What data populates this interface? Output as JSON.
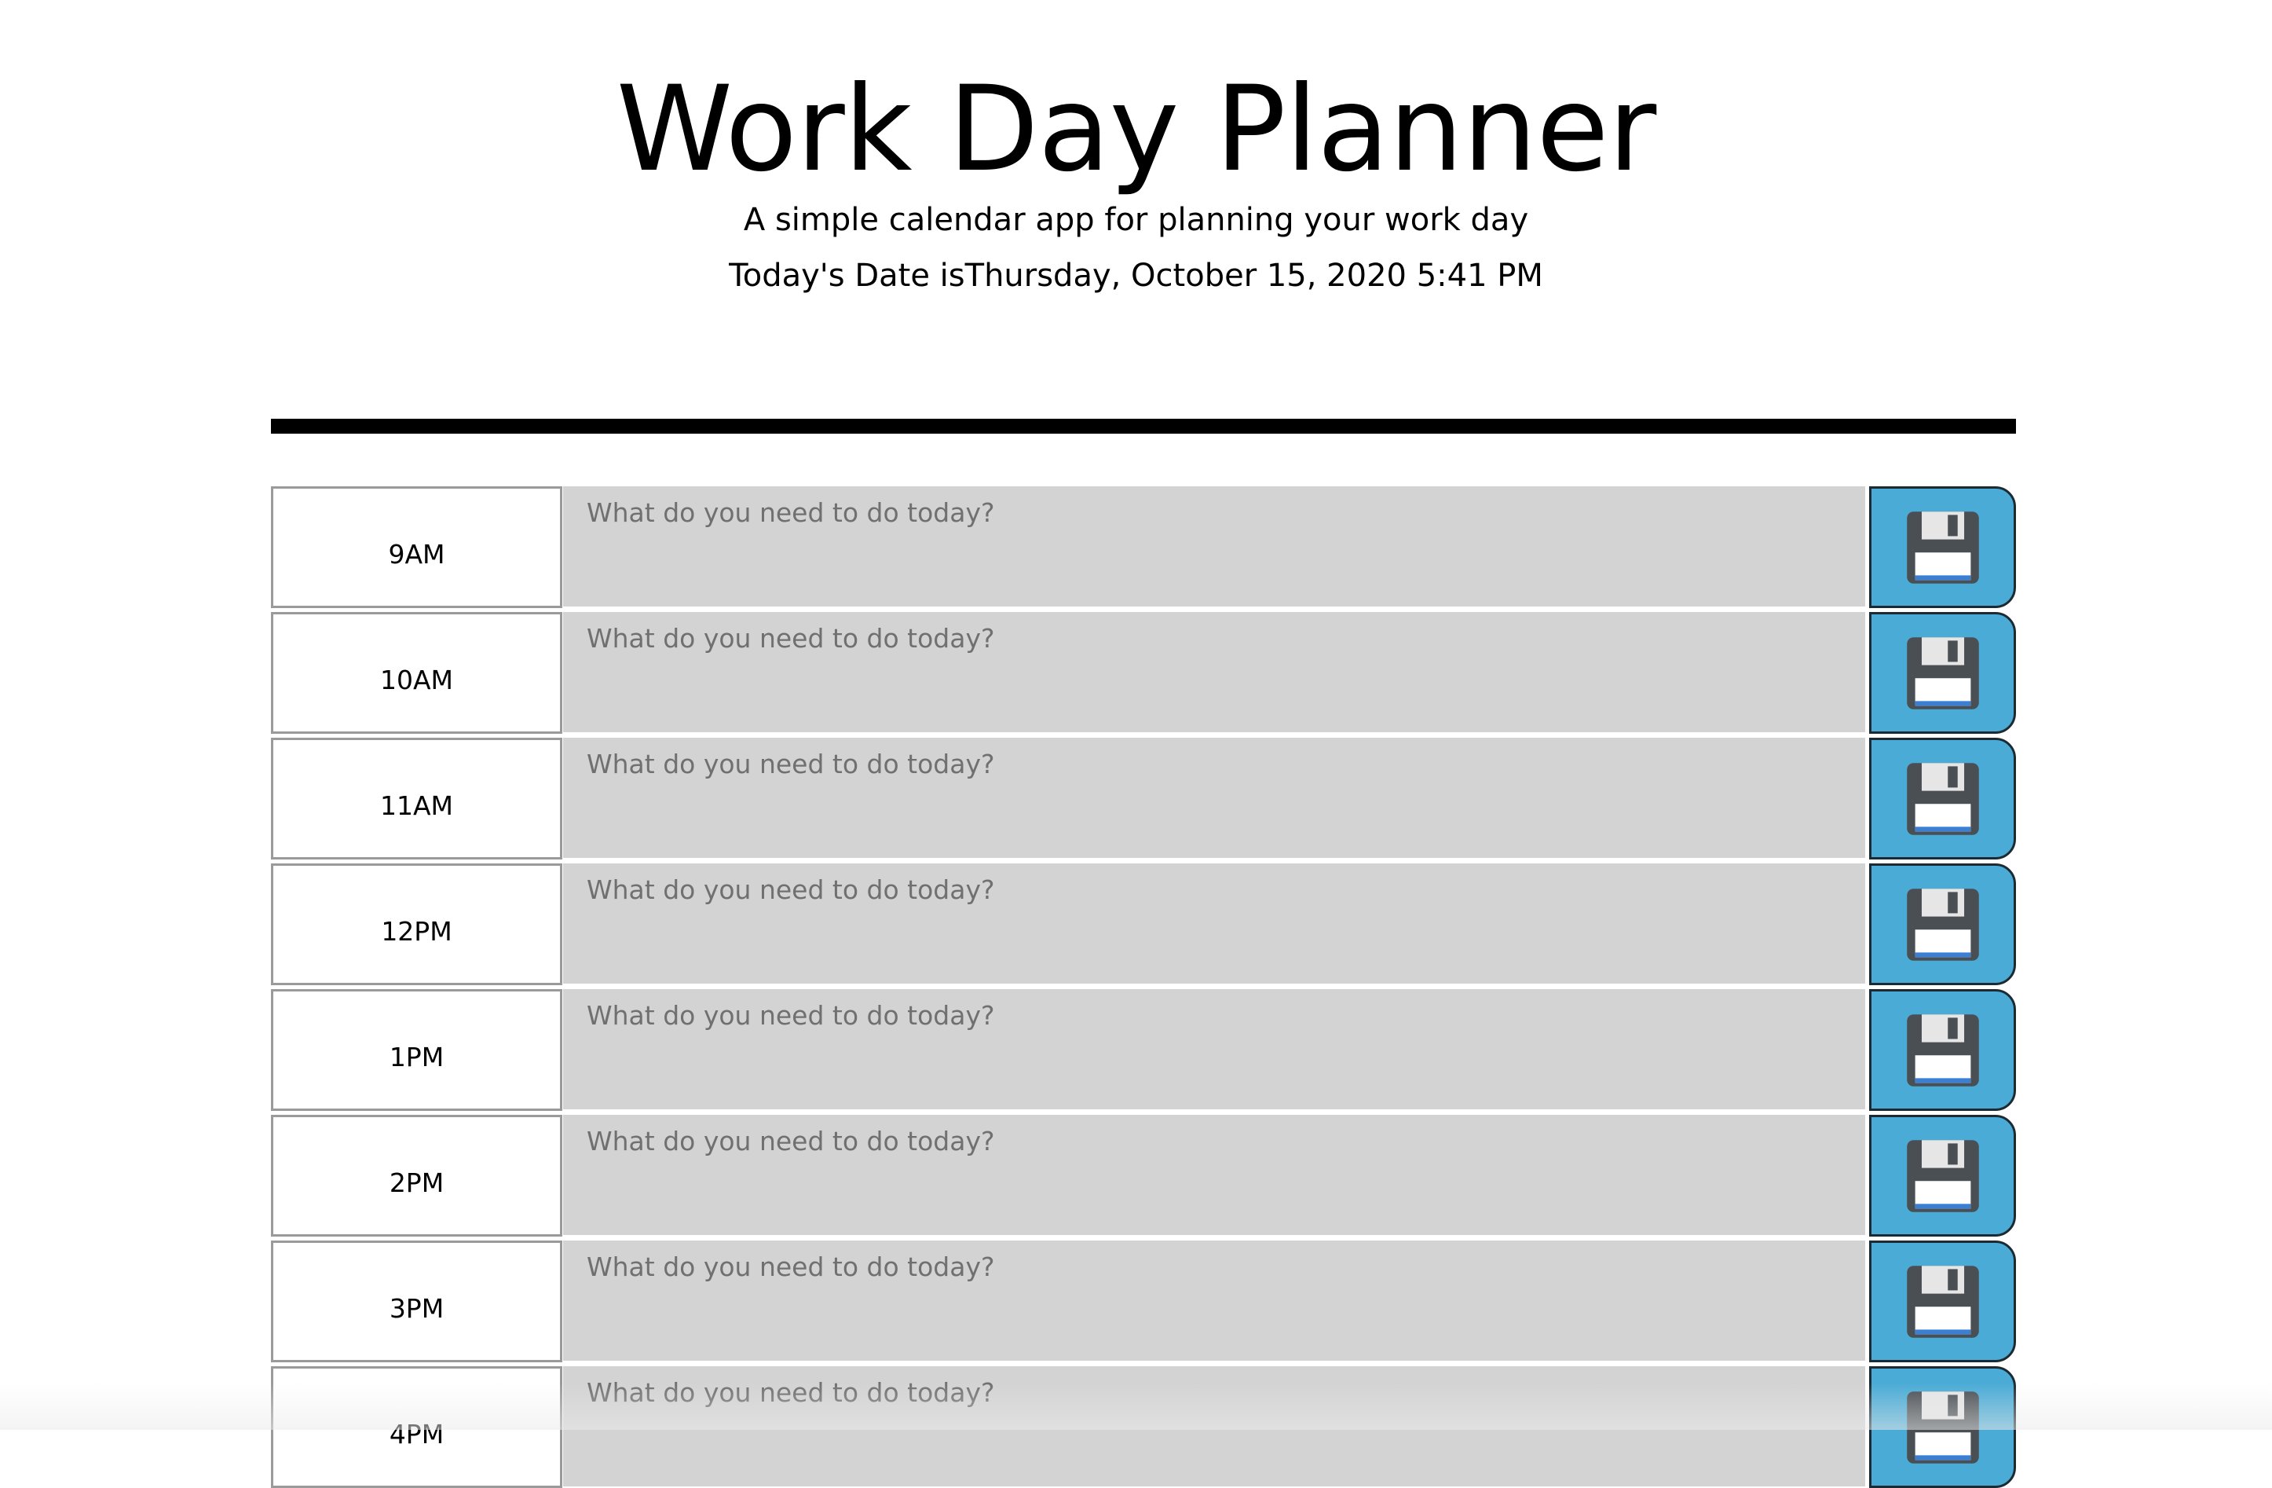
{
  "header": {
    "title": "Work Day Planner",
    "subtitle": "A simple calendar app for planning your work day",
    "date_line": "Today's Date isThursday, October 15, 2020 5:41 PM"
  },
  "colors": {
    "task_background": "#d3d3d3",
    "save_button": "#4aabd6",
    "divider": "#000000"
  },
  "planner": {
    "task_placeholder": "What do you need to do today?",
    "save_icon": "floppy-disk-icon",
    "rows": [
      {
        "hour": "9AM",
        "task": ""
      },
      {
        "hour": "10AM",
        "task": ""
      },
      {
        "hour": "11AM",
        "task": ""
      },
      {
        "hour": "12PM",
        "task": ""
      },
      {
        "hour": "1PM",
        "task": ""
      },
      {
        "hour": "2PM",
        "task": ""
      },
      {
        "hour": "3PM",
        "task": ""
      },
      {
        "hour": "4PM",
        "task": ""
      }
    ]
  }
}
